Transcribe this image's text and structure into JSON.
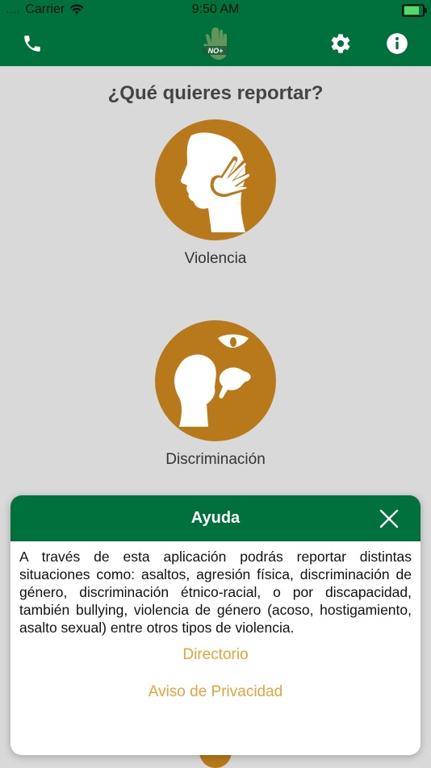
{
  "status_bar": {
    "carrier": "Carrier",
    "time": "9:50 AM"
  },
  "nav": {
    "logo_text": "NO+",
    "icons": [
      "phone-icon",
      "gear-icon",
      "info-icon"
    ]
  },
  "main": {
    "title": "¿Qué quieres reportar?",
    "categories": [
      {
        "label": "Violencia",
        "icon": "violence-icon"
      },
      {
        "label": "Discriminación",
        "icon": "discrimination-icon"
      }
    ]
  },
  "modal": {
    "title": "Ayuda",
    "body": "A través de esta aplicación podrás reportar distintas situaciones como: asaltos, agresión física, discriminación de género, discriminación étnico-racial, o por discapacidad, también bullying, violencia de género (acoso, hostigamiento, asalto sexual) entre otros tipos de violencia.",
    "links": [
      "Directorio",
      "Aviso de Privacidad"
    ]
  },
  "colors": {
    "primary_green": "#00703c",
    "accent_gold": "#b8791b",
    "link_orange": "#e5a33a"
  }
}
